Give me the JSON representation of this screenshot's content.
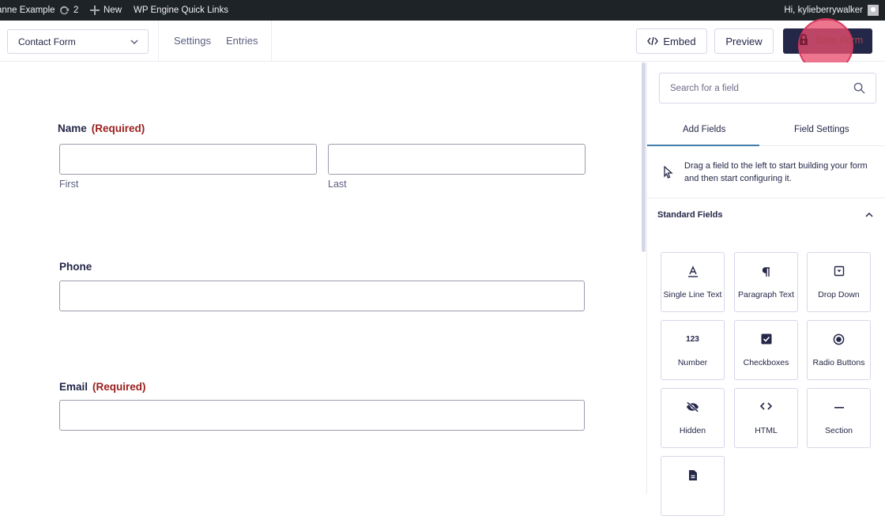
{
  "adminbar": {
    "site_name": "anne Example",
    "updates_count": "2",
    "new_label": "New",
    "quick_links": "WP Engine Quick Links",
    "greeting": "Hi, kylieberrywalker"
  },
  "toolbar": {
    "form_name": "Contact Form",
    "settings_label": "Settings",
    "entries_label": "Entries",
    "embed_label": "Embed",
    "preview_label": "Preview",
    "save_label": "Save Form"
  },
  "form": {
    "name_label": "Name",
    "required_text": "(Required)",
    "first_label": "First",
    "last_label": "Last",
    "phone_label": "Phone",
    "email_label": "Email"
  },
  "sidebar": {
    "search_placeholder": "Search for a field",
    "tabs": [
      {
        "label": "Add Fields",
        "active": true
      },
      {
        "label": "Field Settings",
        "active": false
      }
    ],
    "hint": "Drag a field to the left to start building your form and then start configuring it.",
    "section_title": "Standard Fields",
    "fields": [
      {
        "label": "Single Line Text",
        "icon": "single-line-text-icon"
      },
      {
        "label": "Paragraph Text",
        "icon": "paragraph-icon"
      },
      {
        "label": "Drop Down",
        "icon": "dropdown-icon"
      },
      {
        "label": "Number",
        "icon": "number-icon",
        "glyph": "123"
      },
      {
        "label": "Checkboxes",
        "icon": "checkbox-icon"
      },
      {
        "label": "Radio Buttons",
        "icon": "radio-icon"
      },
      {
        "label": "Hidden",
        "icon": "eye-slash-icon"
      },
      {
        "label": "HTML",
        "icon": "code-icon"
      },
      {
        "label": "Section",
        "icon": "section-line-icon"
      },
      {
        "label": "",
        "icon": "document-icon"
      }
    ]
  },
  "colors": {
    "admin_bar": "#1d2327",
    "primary_dark": "#242748",
    "required_red": "#9b1c1c",
    "active_tab": "#3e7da6",
    "click_highlight": "#e84e6e"
  }
}
